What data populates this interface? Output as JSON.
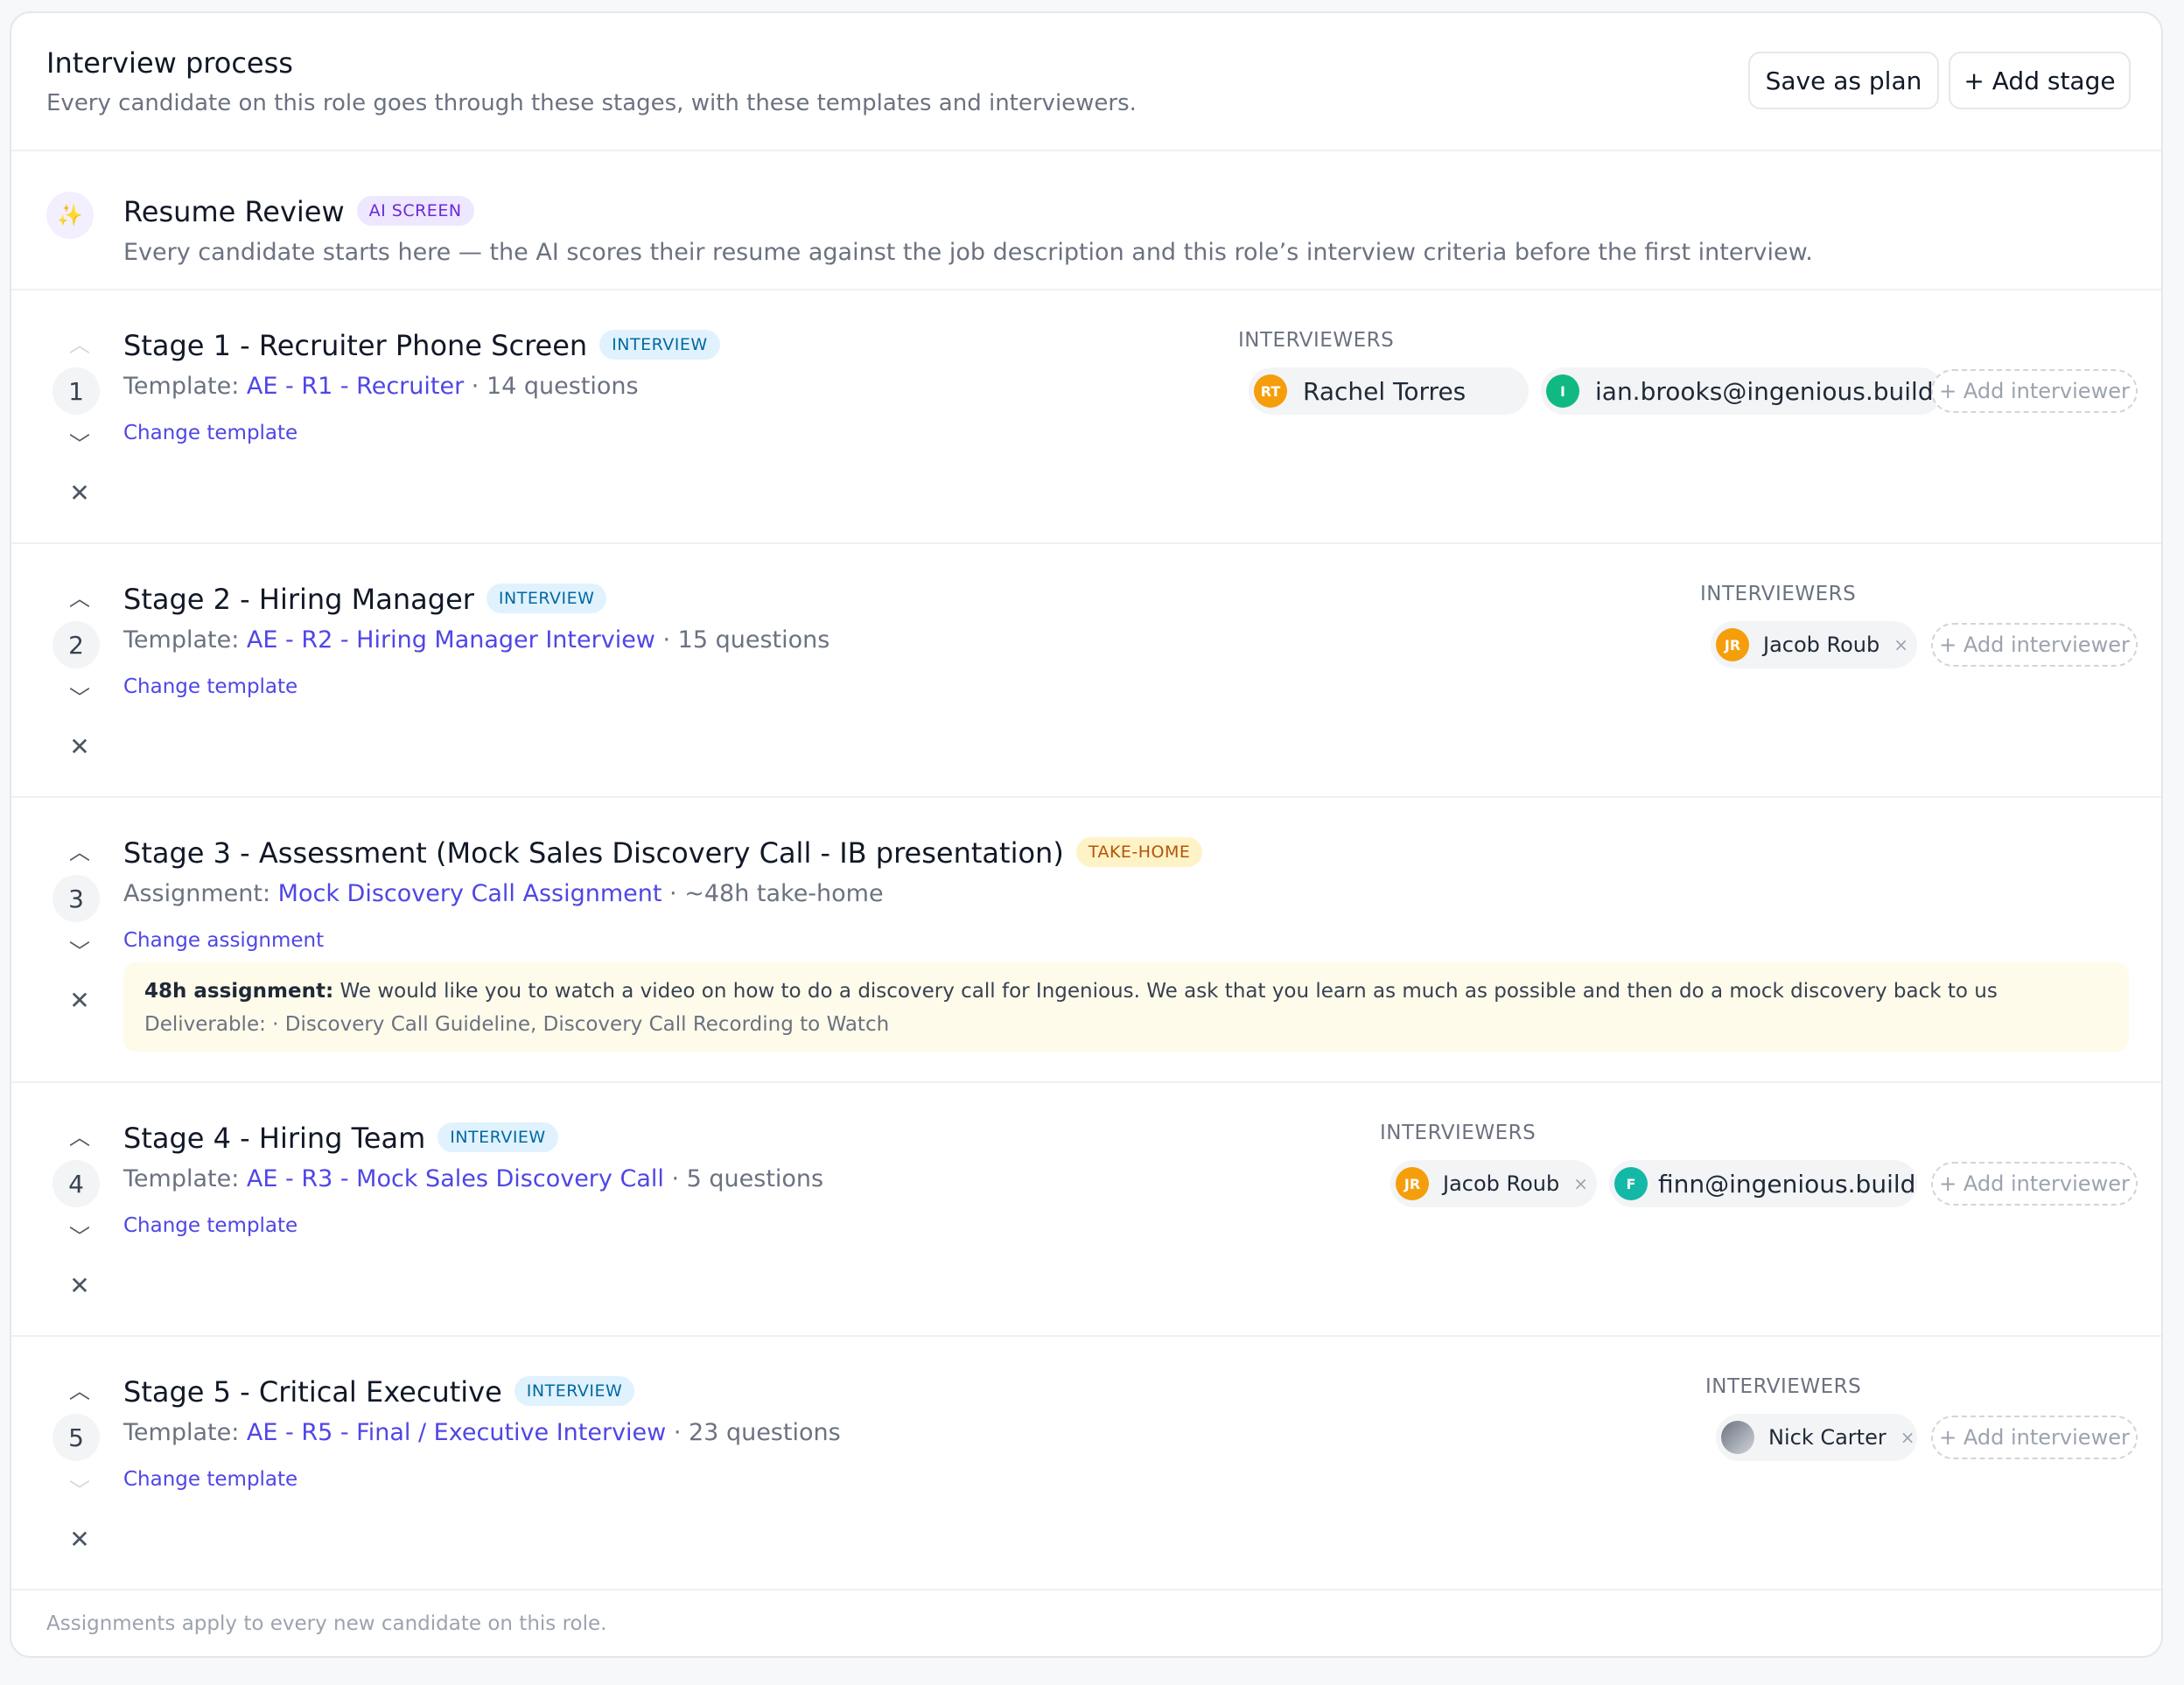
{
  "header": {
    "title": "Interview process",
    "subtitle": "Every candidate on this role goes through these stages, with these templates and interviewers.",
    "save_plan_label": "Save as plan",
    "add_stage_label": "+ Add stage"
  },
  "resume": {
    "title": "Resume Review",
    "badge": "AI SCREEN",
    "description": "Every candidate starts here — the AI scores their resume against the job description and this role’s interview criteria before the first interview."
  },
  "common": {
    "interviewers_label": "INTERVIEWERS",
    "add_interviewer_label": "+ Add interviewer",
    "chip_remove": "×",
    "sep": " · "
  },
  "stages": [
    {
      "number": "1",
      "title": "Stage 1 - Recruiter Phone Screen",
      "badge": "INTERVIEW",
      "prefix": "Template: ",
      "link": "AE - R1 - Recruiter",
      "meta": "14 questions",
      "change": "Change template",
      "interviewers": [
        {
          "initials": "RT",
          "name": "Rachel Torres"
        },
        {
          "initials": "I",
          "name": "ian.brooks@ingenious.build"
        }
      ]
    },
    {
      "number": "2",
      "title": "Stage 2 - Hiring Manager",
      "badge": "INTERVIEW",
      "prefix": "Template: ",
      "link": "AE - R2 - Hiring Manager Interview",
      "meta": "15 questions",
      "change": "Change template",
      "interviewers": [
        {
          "initials": "JR",
          "name": "Jacob Roub"
        }
      ]
    },
    {
      "number": "3",
      "title": "Stage 3 - Assessment (Mock Sales Discovery Call - IB presentation)",
      "badge": "TAKE-HOME",
      "prefix": "Assignment: ",
      "link": "Mock Discovery Call Assignment",
      "meta": "~48h take-home",
      "change": "Change assignment",
      "assignment_label": "48h assignment:",
      "assignment_text": "We would like you to watch a video on how to do a discovery call for Ingenious. We ask that you learn as much as possible and then do a mock discovery back to us",
      "deliverable": "Deliverable: · Discovery Call Guideline, Discovery Call Recording to Watch"
    },
    {
      "number": "4",
      "title": "Stage 4 - Hiring Team",
      "badge": "INTERVIEW",
      "prefix": "Template: ",
      "link": "AE - R3 - Mock Sales Discovery Call",
      "meta": "5 questions",
      "change": "Change template",
      "interviewers": [
        {
          "initials": "JR",
          "name": "Jacob Roub"
        },
        {
          "initials": "F",
          "name": "finn@ingenious.build"
        }
      ]
    },
    {
      "number": "5",
      "title": "Stage 5 - Critical Executive",
      "badge": "INTERVIEW",
      "prefix": "Template: ",
      "link": "AE - R5 - Final / Executive Interview",
      "meta": "23 questions",
      "change": "Change template",
      "interviewers": [
        {
          "name": "Nick Carter"
        }
      ]
    }
  ],
  "footer": "Assignments apply to every new candidate on this role.",
  "colors": {
    "accent": "#4f46e5",
    "ai_badge": "#6d28d9",
    "interview_badge": "#0369a1",
    "takehome_badge": "#b45309"
  }
}
